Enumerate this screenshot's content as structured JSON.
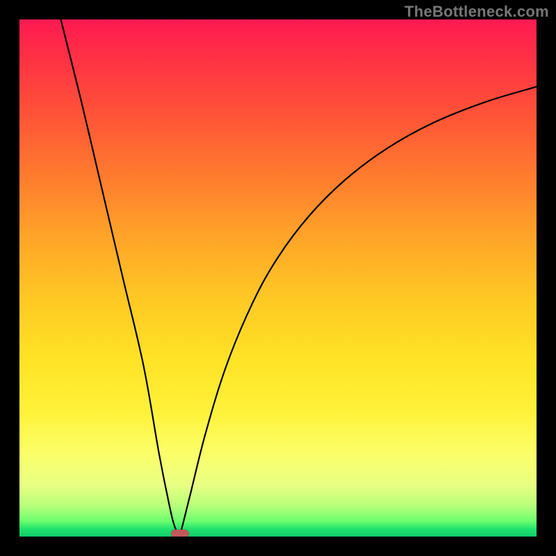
{
  "watermark": "TheBottleneck.com",
  "chart_data": {
    "type": "line",
    "title": "",
    "xlabel": "",
    "ylabel": "",
    "xlim": [
      0,
      100
    ],
    "ylim": [
      0,
      100
    ],
    "grid": false,
    "legend": false,
    "series": [
      {
        "name": "left-branch",
        "x": [
          8,
          12,
          16,
          20,
          24,
          27,
          29,
          30,
          31
        ],
        "values": [
          100,
          84,
          67,
          50,
          33,
          16,
          6,
          2,
          0
        ]
      },
      {
        "name": "right-branch",
        "x": [
          31,
          33,
          36,
          40,
          45,
          50,
          56,
          63,
          71,
          80,
          90,
          100
        ],
        "values": [
          0,
          8,
          20,
          33,
          45,
          54,
          62,
          69,
          75,
          80,
          84,
          87
        ]
      }
    ],
    "marker": {
      "x": 31,
      "y": 0
    }
  },
  "colors": {
    "background": "#000000",
    "curve": "#000000",
    "marker": "#c25a5a",
    "watermark": "#777777"
  }
}
